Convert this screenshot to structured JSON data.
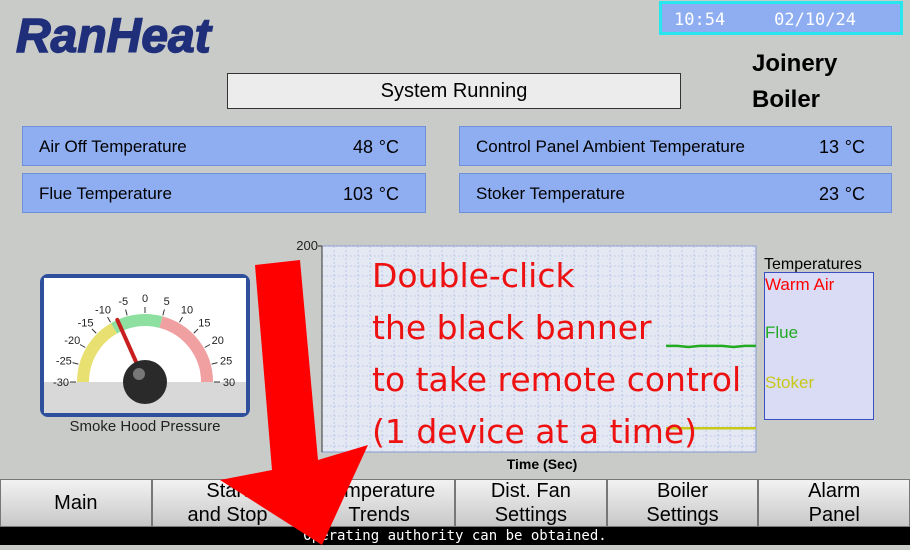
{
  "header": {
    "logo_text": "RanHeat",
    "time": "10:54",
    "date": "02/10/24",
    "boiler_name_line1": "Joinery",
    "boiler_name_line2": "Boiler"
  },
  "status": "System Running",
  "temperatures": [
    {
      "label": "Air Off Temperature",
      "value": "48",
      "unit": "°C"
    },
    {
      "label": "Control Panel Ambient Temperature",
      "value": "13",
      "unit": "°C"
    },
    {
      "label": "Flue Temperature",
      "value": "103",
      "unit": "°C"
    },
    {
      "label": "Stoker Temperature",
      "value": "23",
      "unit": "°C"
    }
  ],
  "gauge": {
    "label": "Smoke Hood Pressure",
    "ticks": [
      "-30",
      "-25",
      "-20",
      "-15",
      "-10",
      "-5",
      "0",
      "5",
      "10",
      "15",
      "20",
      "25",
      "30"
    ],
    "value": -8,
    "min": -30,
    "max": 30
  },
  "chart_data": {
    "type": "line",
    "xlabel": "Time (Sec)",
    "ylabel": "",
    "y_tick_top": "200",
    "ylim": [
      0,
      200
    ],
    "grid": true,
    "legend_title": "Temperatures",
    "legend_position": "right",
    "series": [
      {
        "name": "Warm Air",
        "color": "#ff0000",
        "values": []
      },
      {
        "name": "Flue",
        "color": "#22aa22",
        "values": [
          103,
          103,
          102,
          103,
          103,
          103,
          102,
          103,
          103
        ]
      },
      {
        "name": "Stoker",
        "color": "#c8c81a",
        "values": [
          23,
          23,
          23,
          23,
          23,
          23,
          23,
          23,
          23
        ]
      }
    ]
  },
  "nav": [
    {
      "line1": "Main",
      "line2": ""
    },
    {
      "line1": "Start",
      "line2": "and Stop"
    },
    {
      "line1": "Temperature",
      "line2": "Trends"
    },
    {
      "line1": "Dist. Fan",
      "line2": "Settings"
    },
    {
      "line1": "Boiler",
      "line2": "Settings"
    },
    {
      "line1": "Alarm",
      "line2": "Panel"
    }
  ],
  "banner": "Operating authority can be obtained.",
  "overlay": {
    "line1": "Double-click",
    "line2": "the black banner",
    "line3": "to take remote control",
    "line4": "(1 device at a time)"
  },
  "colors": {
    "panel_bg": "#c9cbc9",
    "tile_blue": "#8faef2",
    "overlay_red": "#ee1111"
  }
}
